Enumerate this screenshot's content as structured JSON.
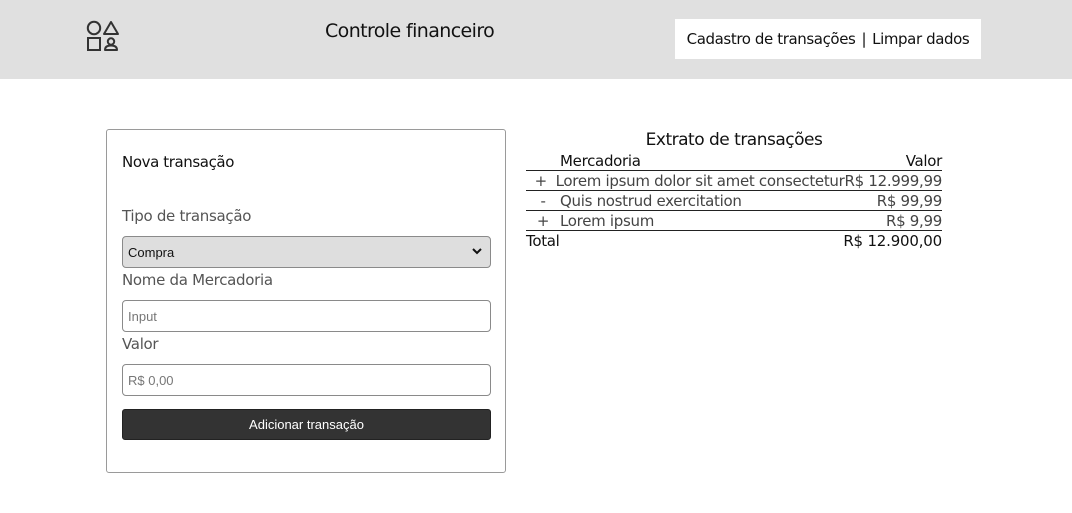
{
  "header": {
    "title": "Controle financeiro",
    "logo_icon": "shapes-icon",
    "nav": {
      "register_label": "Cadastro de transações",
      "separator": "|",
      "clear_label": "Limpar dados"
    },
    "background": "#e0e0e0"
  },
  "form": {
    "title": "Nova transação",
    "type_label": "Tipo de transação",
    "type_value": "Compra",
    "name_label": "Nome da Mercadoria",
    "name_placeholder": "Input",
    "value_label": "Valor",
    "value_placeholder": "R$ 0,00",
    "submit_label": "Adicionar transação",
    "submit_color": "#333333"
  },
  "statement": {
    "title": "Extrato de transações",
    "columns": {
      "name": "Mercadoria",
      "value": "Valor"
    },
    "rows": [
      {
        "sign": "+",
        "name": "Lorem ipsum dolor sit amet consectetur",
        "value": "R$ 12.999,99"
      },
      {
        "sign": "-",
        "name": "Quis nostrud exercitation",
        "value": "R$ 99,99"
      },
      {
        "sign": "+",
        "name": "Lorem ipsum",
        "value": "R$ 9,99"
      }
    ],
    "total_label": "Total",
    "total_value": "R$ 12.900,00"
  }
}
